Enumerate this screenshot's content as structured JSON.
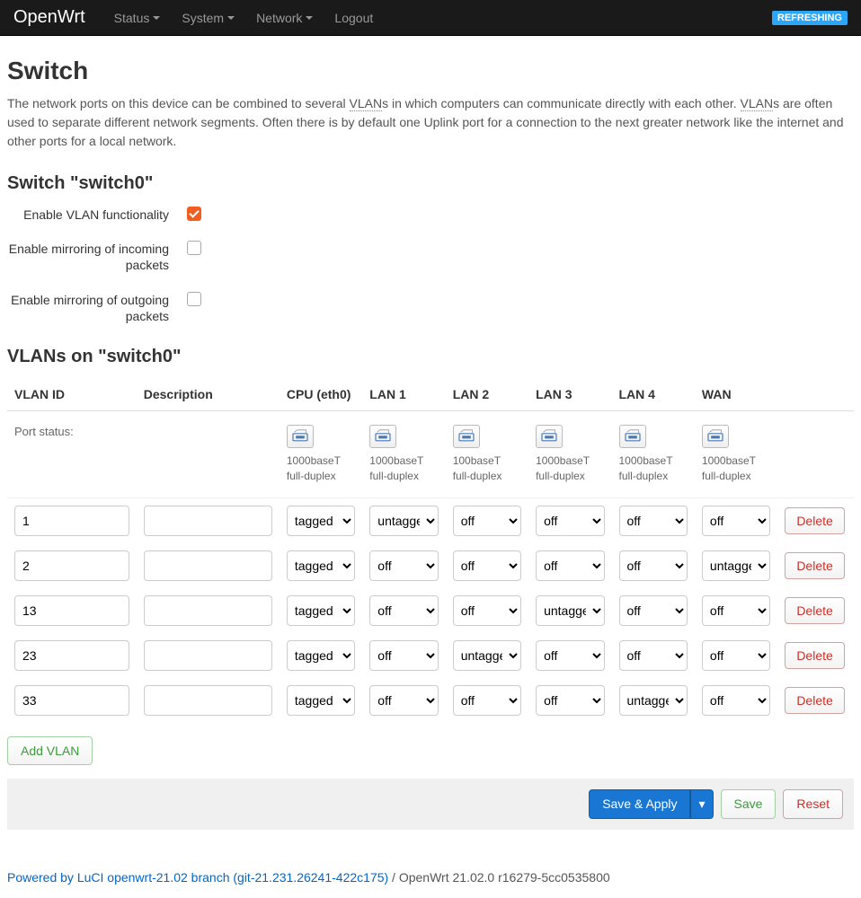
{
  "nav": {
    "brand": "OpenWrt",
    "items": [
      "Status",
      "System",
      "Network",
      "Logout"
    ],
    "dropdown": [
      true,
      true,
      true,
      false
    ],
    "refreshing": "REFRESHING"
  },
  "page": {
    "title": "Switch",
    "intro_pre": "The network ports on this device can be combined to several ",
    "vlan_abbr": "VLAN",
    "intro_mid": "s in which computers can communicate directly with each other. ",
    "intro_post": "s are often used to separate different network segments. Often there is by default one Uplink port for a connection to the next greater network like the internet and other ports for a local network."
  },
  "switch": {
    "heading": "Switch \"switch0\"",
    "enable_vlan_label": "Enable VLAN functionality",
    "enable_vlan_checked": true,
    "mirror_in_label": "Enable mirroring of incoming packets",
    "mirror_in_checked": false,
    "mirror_out_label": "Enable mirroring of outgoing packets",
    "mirror_out_checked": false
  },
  "vlans": {
    "heading": "VLANs on \"switch0\"",
    "columns": [
      "VLAN ID",
      "Description",
      "CPU (eth0)",
      "LAN 1",
      "LAN 2",
      "LAN 3",
      "LAN 4",
      "WAN"
    ],
    "port_status_label": "Port status:",
    "ports": [
      {
        "speed": "1000baseT",
        "duplex": "full-duplex"
      },
      {
        "speed": "1000baseT",
        "duplex": "full-duplex"
      },
      {
        "speed": "100baseT",
        "duplex": "full-duplex"
      },
      {
        "speed": "1000baseT",
        "duplex": "full-duplex"
      },
      {
        "speed": "1000baseT",
        "duplex": "full-duplex"
      },
      {
        "speed": "1000baseT",
        "duplex": "full-duplex"
      }
    ],
    "select_options": [
      "tagged",
      "untagged",
      "off"
    ],
    "rows": [
      {
        "id": "1",
        "desc": "",
        "ports": [
          "tagged",
          "untagged",
          "off",
          "off",
          "off",
          "off"
        ]
      },
      {
        "id": "2",
        "desc": "",
        "ports": [
          "tagged",
          "off",
          "off",
          "off",
          "off",
          "untagged"
        ]
      },
      {
        "id": "13",
        "desc": "",
        "ports": [
          "tagged",
          "off",
          "off",
          "untagged",
          "off",
          "off"
        ]
      },
      {
        "id": "23",
        "desc": "",
        "ports": [
          "tagged",
          "off",
          "untagged",
          "off",
          "off",
          "off"
        ]
      },
      {
        "id": "33",
        "desc": "",
        "ports": [
          "tagged",
          "off",
          "off",
          "off",
          "untagged",
          "off"
        ]
      }
    ],
    "delete_label": "Delete",
    "add_label": "Add VLAN"
  },
  "actions": {
    "save_apply": "Save & Apply",
    "save": "Save",
    "reset": "Reset"
  },
  "footer": {
    "link_text": "Powered by LuCI openwrt-21.02 branch (git-21.231.26241-422c175)",
    "version": " / OpenWrt 21.02.0 r16279-5cc0535800"
  }
}
